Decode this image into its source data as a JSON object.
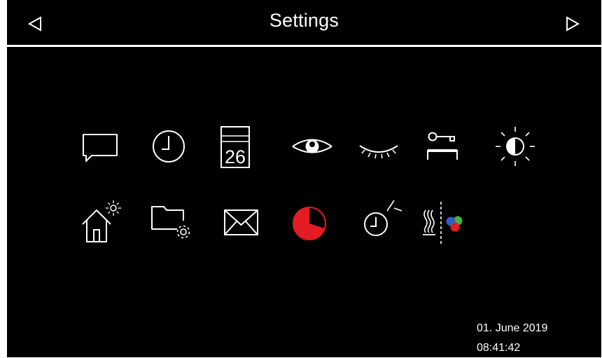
{
  "header": {
    "title": "Settings",
    "prev_icon": "triangle-left-icon",
    "next_icon": "triangle-right-icon"
  },
  "icons": {
    "row1": [
      "message-icon",
      "clock-icon",
      "calendar-icon",
      "eye-open-icon",
      "eye-closed-icon",
      "key-lock-icon",
      "brightness-icon"
    ],
    "row2": [
      "home-sun-icon",
      "folder-settings-icon",
      "envelope-icon",
      "pie-progress-icon",
      "clock-alarm-icon",
      "heat-color-icon"
    ]
  },
  "calendar": {
    "day": "26"
  },
  "pie": {
    "accent_color": "#e31b23",
    "fill_fraction": 0.7
  },
  "footer": {
    "date": "01. June 2019",
    "time": "08:41:42"
  }
}
